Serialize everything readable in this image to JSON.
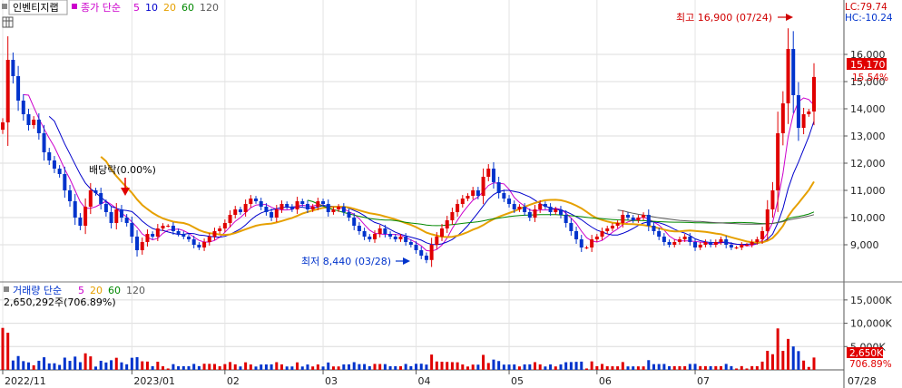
{
  "stock_tab": "인벤티지랩",
  "ma_title": "종가 단순",
  "ma_periods": [
    "5",
    "10",
    "20",
    "60",
    "120"
  ],
  "ma_colors": [
    "#cc00cc",
    "#0000cc",
    "#e6a000",
    "#008800",
    "#5a5a5a"
  ],
  "vol_title": "거래량 단순",
  "vol_periods": [
    "5",
    "20",
    "60",
    "120"
  ],
  "vol_info": "2,650,292주(706.89%)",
  "lc_label": "LC:79.74",
  "hc_label": "HC:-10.24",
  "high_marker": "최고 16,900 (07/24)",
  "low_marker": "최저 8,440 (03/28)",
  "dividend_marker": "배당락(0.00%)",
  "current_price": "15,170",
  "current_change": "15.54%",
  "current_volume": "2,650K",
  "current_volume_pct": "706.89%",
  "colors": {
    "up": "#e00000",
    "down": "#0033cc",
    "grid": "#d8d8d8",
    "axis": "#333333"
  },
  "chart_data": [
    {
      "type": "candlestick",
      "title": "인벤티지랩 종가 단순 5 10 20 60 120",
      "period": "2022/11 - 2023/07",
      "x_tick_labels": [
        "2022/11",
        "2023/01",
        "02",
        "03",
        "04",
        "05",
        "06",
        "07",
        "07/28"
      ],
      "y_tick_labels": [
        "9,000",
        "10,000",
        "11,000",
        "12,000",
        "13,000",
        "14,000",
        "15,000",
        "16,000"
      ],
      "ylim": [
        8000,
        17000
      ],
      "grid": true,
      "high": {
        "value": 16900,
        "date": "07/24"
      },
      "low": {
        "value": 8440,
        "date": "03/28"
      },
      "last_close": 15170,
      "last_change_pct": 15.54,
      "close_series": [
        13500,
        15800,
        15200,
        14300,
        13800,
        13400,
        13600,
        13100,
        12400,
        12100,
        11800,
        11600,
        11000,
        10600,
        10000,
        9700,
        10400,
        11000,
        10900,
        10500,
        10200,
        9800,
        10300,
        10000,
        9800,
        9300,
        8800,
        9100,
        9400,
        9300,
        9600,
        9700,
        9700,
        9500,
        9400,
        9300,
        9200,
        9000,
        8900,
        9100,
        9300,
        9500,
        9600,
        9800,
        10100,
        10300,
        10200,
        10500,
        10700,
        10600,
        10400,
        10200,
        10000,
        10300,
        10500,
        10400,
        10300,
        10600,
        10500,
        10300,
        10400,
        10600,
        10500,
        10200,
        10300,
        10400,
        10200,
        10000,
        9700,
        9500,
        9300,
        9200,
        9400,
        9600,
        9400,
        9300,
        9200,
        9300,
        9100,
        9000,
        8800,
        8600,
        8440,
        9000,
        9300,
        9600,
        9900,
        10200,
        10500,
        10700,
        10800,
        11000,
        10800,
        11500,
        11800,
        11300,
        10900,
        10700,
        10500,
        10300,
        10400,
        10200,
        10000,
        10300,
        10500,
        10400,
        10200,
        10300,
        10100,
        9800,
        9500,
        9200,
        8900,
        8900,
        9200,
        9300,
        9500,
        9600,
        9700,
        9800,
        10100,
        10000,
        9900,
        10000,
        10100,
        9700,
        9500,
        9300,
        9100,
        9000,
        9100,
        9200,
        9300,
        9100,
        8900,
        9000,
        9100,
        9000,
        9100,
        9200,
        9000,
        8900,
        8900,
        9000,
        9000,
        9100,
        9200,
        9500,
        10300,
        11000,
        13100,
        14200,
        16200,
        14500,
        13300,
        13800,
        13900,
        15170
      ]
    },
    {
      "type": "bar",
      "title": "거래량 단순 5 20 60 120",
      "y_tick_labels": [
        "5,000K",
        "10,000K",
        "15,000K"
      ],
      "ylim": [
        0,
        17500
      ],
      "unit": "K"
    }
  ]
}
